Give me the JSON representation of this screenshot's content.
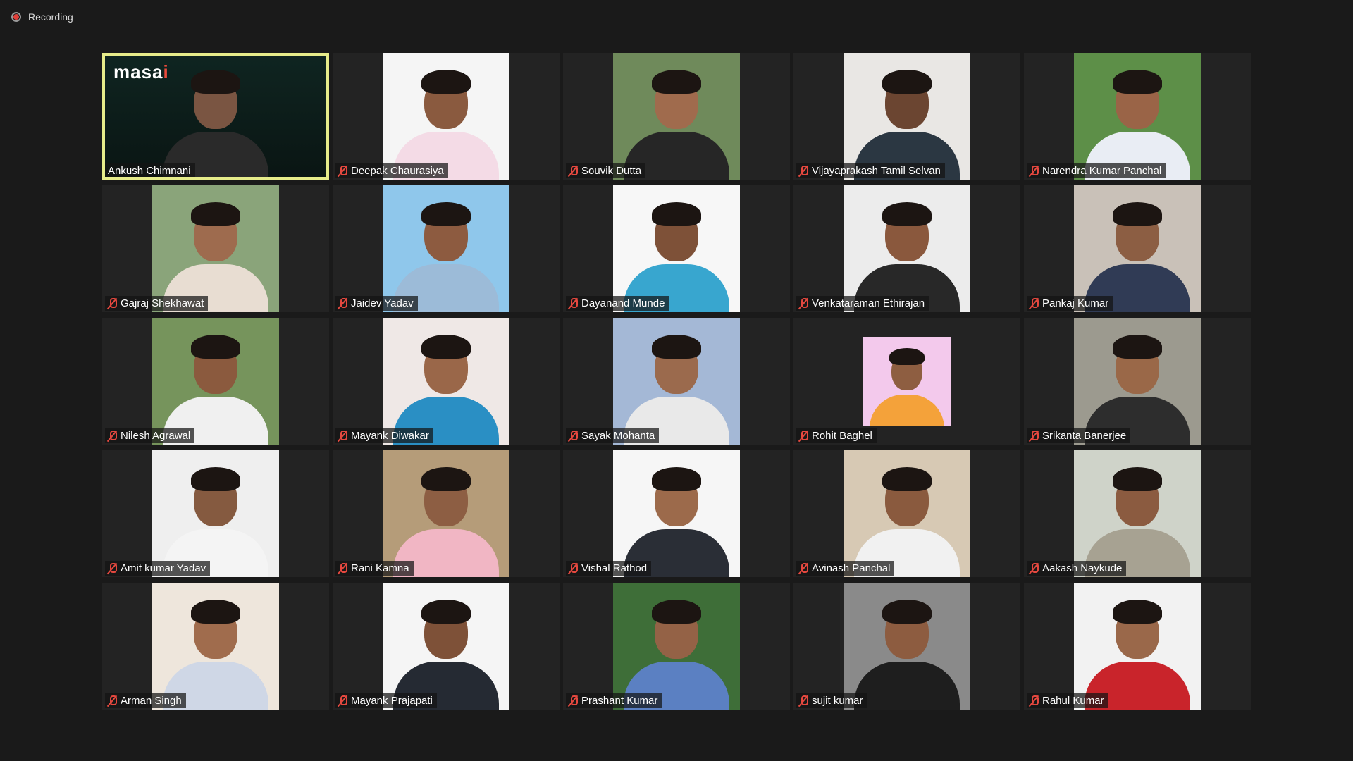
{
  "recording": {
    "label": "Recording",
    "icon": "record-icon",
    "color": "#e0403a"
  },
  "host": {
    "name": "Ankush Chimnani",
    "logo": "masai",
    "highlight_color": "#e6ec8a"
  },
  "participants": [
    {
      "name": "Deepak Chaurasiya",
      "muted": true,
      "bg": "#f5f5f5",
      "skin": "#8a5a3f",
      "shirt": "#f4dbe6"
    },
    {
      "name": "Souvik Dutta",
      "muted": true,
      "bg": "#6f8a5b",
      "skin": "#a06b4d",
      "shirt": "#262626"
    },
    {
      "name": "Vijayaprakash Tamil Selvan",
      "muted": true,
      "bg": "#e9e7e4",
      "skin": "#6b4531",
      "shirt": "#2b3742"
    },
    {
      "name": "Narendra Kumar Panchal",
      "muted": true,
      "bg": "#5d8f48",
      "skin": "#9a6447",
      "shirt": "#e9edf4"
    },
    {
      "name": "Gajraj Shekhawat",
      "muted": true,
      "bg": "#8aa47a",
      "skin": "#9e6b4e",
      "shirt": "#e8ddd2"
    },
    {
      "name": "Jaidev Yadav",
      "muted": true,
      "bg": "#8fc7eb",
      "skin": "#8d5b40",
      "shirt": "#9cbbd8"
    },
    {
      "name": "Dayanand Munde",
      "muted": true,
      "bg": "#f7f7f7",
      "skin": "#7e5138",
      "shirt": "#38a6cf"
    },
    {
      "name": "Venkataraman Ethirajan",
      "muted": true,
      "bg": "#ececec",
      "skin": "#8a583d",
      "shirt": "#282828"
    },
    {
      "name": "Pankaj Kumar",
      "muted": true,
      "bg": "#c9c1b8",
      "skin": "#8c5e43",
      "shirt": "#303b55"
    },
    {
      "name": "Nilesh Agrawal",
      "muted": true,
      "bg": "#76945c",
      "skin": "#8b5a3e",
      "shirt": "#f0f0f0"
    },
    {
      "name": "Mayank Diwakar",
      "muted": true,
      "bg": "#efe8e6",
      "skin": "#9a6749",
      "shirt": "#2a8fc4"
    },
    {
      "name": "Sayak Mohanta",
      "muted": true,
      "bg": "#a4b8d6",
      "skin": "#9b6a4d",
      "shirt": "#e9e9e9"
    },
    {
      "name": "Rohit Baghel",
      "muted": true,
      "small": true,
      "bg": "#f3c9ec",
      "skin": "#8e5e41",
      "shirt": "#f4a23a"
    },
    {
      "name": "Srikanta Banerjee",
      "muted": true,
      "bg": "#9c9a8f",
      "skin": "#9a6848",
      "shirt": "#2d2d2d"
    },
    {
      "name": "Amit kumar Yadav",
      "muted": true,
      "bg": "#efefef",
      "skin": "#855a40",
      "shirt": "#f4f4f4"
    },
    {
      "name": "Rani Kamna",
      "muted": true,
      "bg": "#b59c79",
      "skin": "#8d5e43",
      "shirt": "#f1b6c4"
    },
    {
      "name": "Vishal Rathod",
      "muted": true,
      "bg": "#f6f6f6",
      "skin": "#9c6a4b",
      "shirt": "#2a2e36"
    },
    {
      "name": "Avinash Panchal",
      "muted": true,
      "bg": "#d7c9b4",
      "skin": "#8a5a3e",
      "shirt": "#f1f1f1"
    },
    {
      "name": "Aakash Naykude",
      "muted": true,
      "bg": "#cfd3c9",
      "skin": "#8b5b40",
      "shirt": "#a7a292"
    },
    {
      "name": "Arman Singh",
      "muted": true,
      "bg": "#eee6dc",
      "skin": "#a06c4d",
      "shirt": "#cfd7e6"
    },
    {
      "name": "Mayank Prajapati",
      "muted": true,
      "bg": "#f5f5f5",
      "skin": "#7e5138",
      "shirt": "#252a33"
    },
    {
      "name": "Prashant Kumar",
      "muted": true,
      "bg": "#3e6e38",
      "skin": "#946246",
      "shirt": "#5b80c2"
    },
    {
      "name": "sujit kumar",
      "muted": true,
      "bg": "#8a8a8a",
      "skin": "#8d5c40",
      "shirt": "#1e1e1e"
    },
    {
      "name": "Rahul Kumar",
      "muted": true,
      "bg": "#f2f2f2",
      "skin": "#9a684a",
      "shirt": "#c9242b"
    }
  ]
}
